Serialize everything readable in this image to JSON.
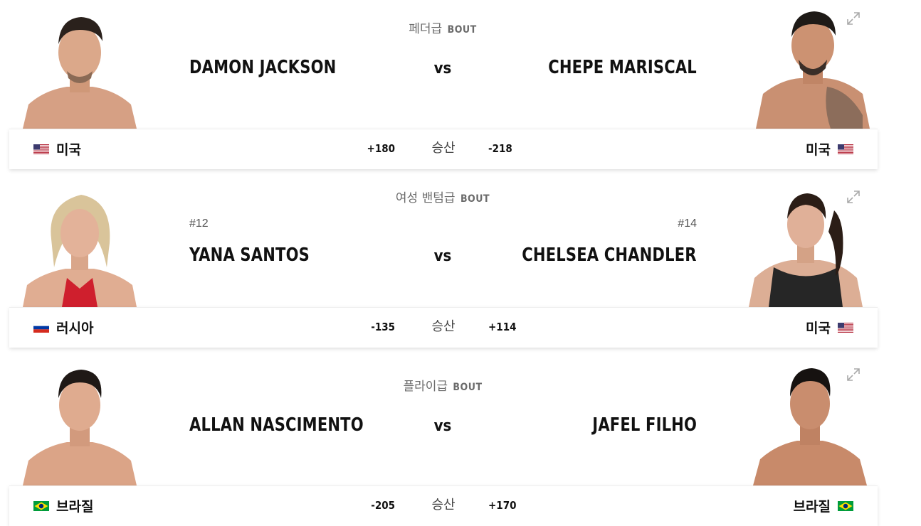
{
  "bouts": [
    {
      "weight_class": "페더급",
      "bout_label": "BOUT",
      "vs_label": "vs",
      "odds_label": "승산",
      "left": {
        "name": "DAMON JACKSON",
        "rank": "",
        "country": "미국",
        "odds": "+180",
        "flag": "us"
      },
      "right": {
        "name": "CHEPE MARISCAL",
        "rank": "",
        "country": "미국",
        "odds": "-218",
        "flag": "us"
      }
    },
    {
      "weight_class": "여성 밴텀급",
      "bout_label": "BOUT",
      "vs_label": "vs",
      "odds_label": "승산",
      "left": {
        "name": "YANA SANTOS",
        "rank": "#12",
        "country": "러시아",
        "odds": "-135",
        "flag": "ru"
      },
      "right": {
        "name": "CHELSEA CHANDLER",
        "rank": "#14",
        "country": "미국",
        "odds": "+114",
        "flag": "us"
      }
    },
    {
      "weight_class": "플라이급",
      "bout_label": "BOUT",
      "vs_label": "vs",
      "odds_label": "승산",
      "left": {
        "name": "ALLAN NASCIMENTO",
        "rank": "",
        "country": "브라질",
        "odds": "-205",
        "flag": "br"
      },
      "right": {
        "name": "JAFEL FILHO",
        "rank": "",
        "country": "브라질",
        "odds": "+170",
        "flag": "br"
      }
    }
  ],
  "icons": {
    "expand": "expand-icon"
  },
  "colors": {
    "text": "#111111",
    "muted": "#6b6b6b",
    "skin": "#d9a283"
  }
}
